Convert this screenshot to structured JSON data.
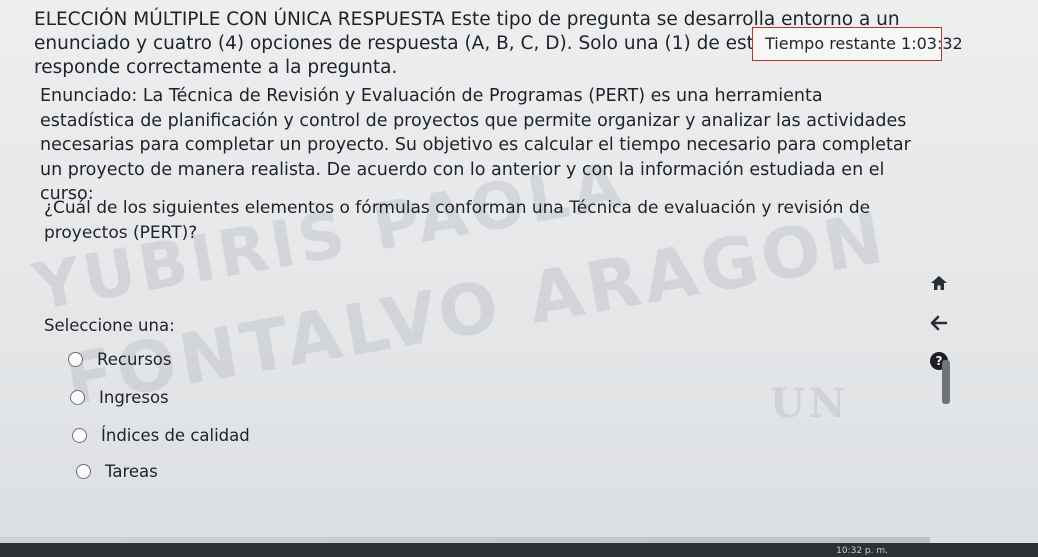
{
  "intro": {
    "text": "ELECCIÓN MÚLTIPLE CON ÚNICA RESPUESTA Este tipo de pregunta se desarrolla entorno a un enunciado y cuatro (4) opciones de respuesta (A, B, C, D). Solo una (1) de estas opciones responde correctamente a la pregunta."
  },
  "timer": {
    "label": "Tiempo restante",
    "value": "1:03:32"
  },
  "stem": {
    "text": "Enunciado: La Técnica de Revisión y Evaluación de Programas (PERT) es una herramienta estadística de planificación y control de proyectos que permite organizar y analizar las actividades necesarias para completar un proyecto. Su objetivo es calcular el tiempo necesario para completar un proyecto de manera realista. De acuerdo con lo anterior y con la información estudiada en el curso:"
  },
  "question": {
    "text": "¿Cuál de los siguientes elementos o fórmulas conforman una Técnica de evaluación y revisión de proyectos (PERT)?"
  },
  "prompt": "Seleccione una:",
  "options": [
    {
      "label": "Recursos"
    },
    {
      "label": "Ingresos"
    },
    {
      "label": "Índices de calidad"
    },
    {
      "label": "Tareas"
    }
  ],
  "watermark": {
    "line1": "YUBIRIS PAOLA",
    "line2": "FONTALVO ARAGON",
    "logo": "UN"
  },
  "icons": {
    "home": "home-icon",
    "back": "arrow-left-icon",
    "help": "question-icon"
  },
  "help_glyph": "?",
  "clock": "10:32 p. m.",
  "colors": {
    "timer_border": "#b8352e",
    "background": "#e6e8ea"
  }
}
